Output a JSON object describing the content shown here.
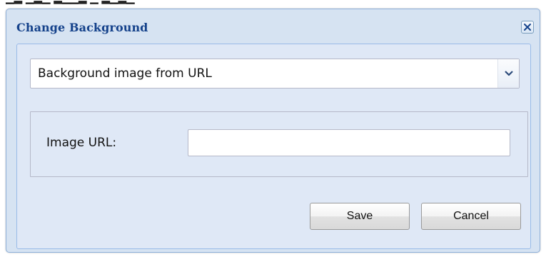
{
  "dialog": {
    "title": "Change Background",
    "close_icon": "close-icon"
  },
  "background_type": {
    "selected": "Background image from URL",
    "trigger_icon": "chevron-down-icon"
  },
  "image_url_field": {
    "label": "Image URL:",
    "value": "",
    "placeholder": ""
  },
  "buttons": {
    "save_label": "Save",
    "cancel_label": "Cancel"
  },
  "colors": {
    "title_text": "#15428b",
    "window_border": "#8fb1da",
    "panel_background": "#dfe8f6"
  }
}
